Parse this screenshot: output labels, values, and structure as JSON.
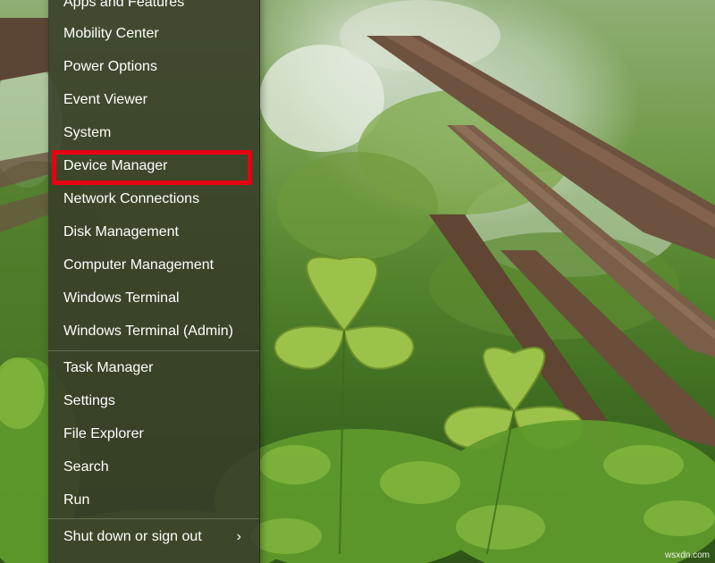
{
  "menu": {
    "items": [
      {
        "label": "Apps and Features"
      },
      {
        "label": "Mobility Center"
      },
      {
        "label": "Power Options"
      },
      {
        "label": "Event Viewer"
      },
      {
        "label": "System"
      },
      {
        "label": "Device Manager"
      },
      {
        "label": "Network Connections"
      },
      {
        "label": "Disk Management"
      },
      {
        "label": "Computer Management"
      },
      {
        "label": "Windows Terminal"
      },
      {
        "label": "Windows Terminal (Admin)"
      },
      {
        "label": "Task Manager"
      },
      {
        "label": "Settings"
      },
      {
        "label": "File Explorer"
      },
      {
        "label": "Search"
      },
      {
        "label": "Run"
      },
      {
        "label": "Shut down or sign out"
      }
    ],
    "highlighted_item": "Device Manager",
    "submenu_icon": "chevron-right-icon"
  },
  "colors": {
    "highlight_border": "#e60012",
    "menu_text": "#ffffff"
  },
  "watermark": "wsxdn.com"
}
